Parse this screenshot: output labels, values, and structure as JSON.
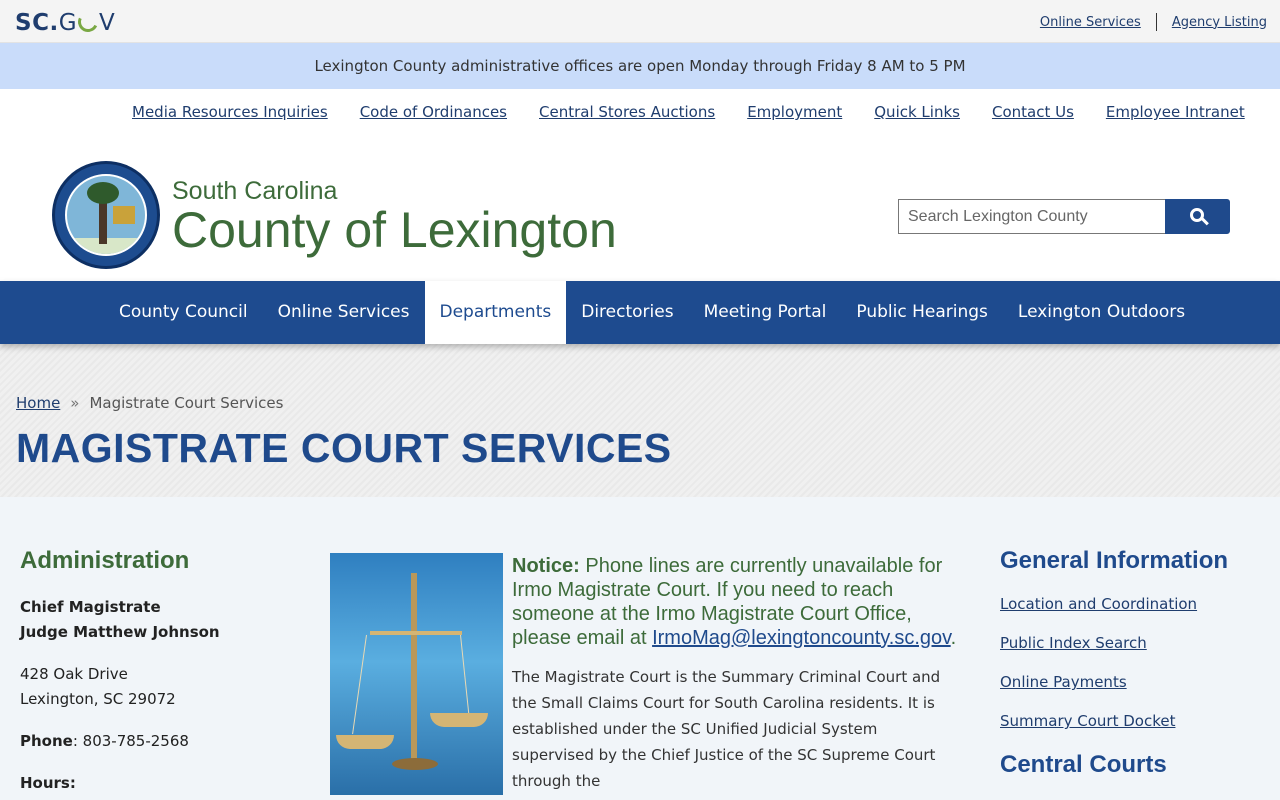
{
  "scgov": {
    "logo_sc": "SC",
    "logo_dot": ".",
    "logo_g": "G",
    "logo_v": "V",
    "links": [
      "Online Services",
      "Agency Listing"
    ]
  },
  "alert": "Lexington County administrative offices are open Monday through Friday 8 AM to 5 PM",
  "utility_nav": [
    "Media Resources Inquiries",
    "Code of Ordinances",
    "Central Stores Auctions",
    "Employment",
    "Quick Links",
    "Contact Us",
    "Employee Intranet"
  ],
  "header": {
    "subtitle": "South Carolina",
    "title": "County of Lexington",
    "search_placeholder": "Search Lexington County"
  },
  "main_nav": {
    "items": [
      "County Council",
      "Online Services",
      "Departments",
      "Directories",
      "Meeting Portal",
      "Public Hearings",
      "Lexington Outdoors"
    ],
    "active": "Departments"
  },
  "breadcrumb": {
    "home": "Home",
    "separator": "»",
    "current": "Magistrate Court Services"
  },
  "page_title": "MAGISTRATE COURT SERVICES",
  "administration": {
    "heading": "Administration",
    "role": "Chief Magistrate",
    "name": "Judge Matthew Johnson",
    "address1": "428 Oak Drive",
    "address2": "Lexington, SC 29072",
    "phone_label": "Phone",
    "phone": ": 803-785-2568",
    "hours_label": "Hours:"
  },
  "notice": {
    "label": "Notice:",
    "text": " Phone lines are currently unavailable for Irmo Magistrate Court. If you need to reach someone at the Irmo Magistrate Court Office, please email at ",
    "email": "IrmoMag@lexingtoncounty.sc.gov",
    "end": "."
  },
  "body_text": "The Magistrate Court is the Summary Criminal Court and the Small Claims Court for South Carolina residents. It is established under the SC Unified Judicial System supervised by the Chief Justice of the SC Supreme Court through the",
  "general_info": {
    "heading": "General Information",
    "links": [
      "Location and Coordination",
      "Public Index Search",
      "Online Payments",
      "Summary Court Docket"
    ],
    "second_heading": "Central Courts"
  }
}
